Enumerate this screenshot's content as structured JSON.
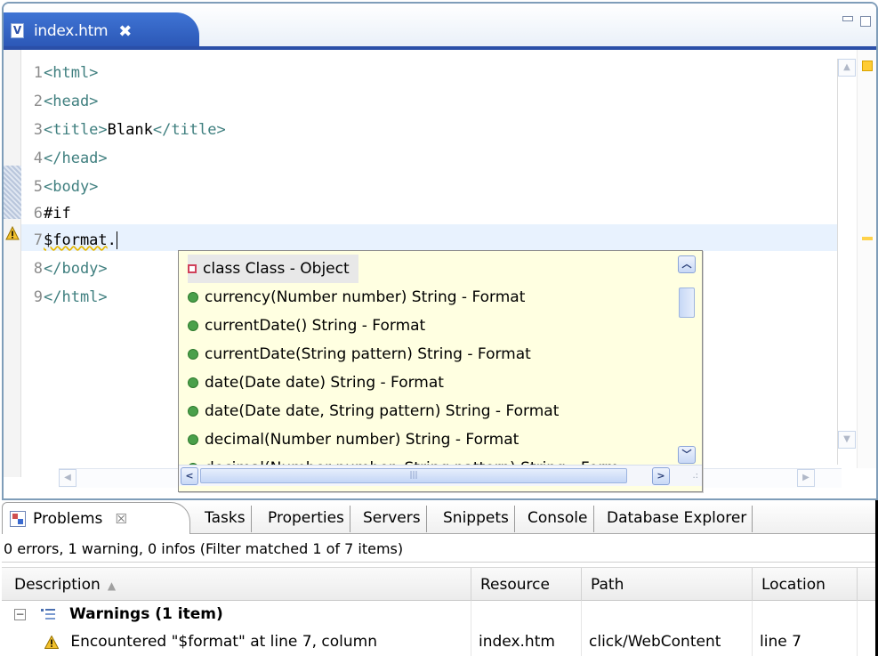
{
  "editor": {
    "tab_label": "index.htm",
    "tab_icon": "V",
    "close_glyph": "✖"
  },
  "code_lines": [
    {
      "num": "1",
      "tokens": [
        {
          "t": "<html>",
          "c": "tag"
        }
      ]
    },
    {
      "num": "2",
      "tokens": [
        {
          "t": "<head>",
          "c": "tag"
        }
      ]
    },
    {
      "num": "3",
      "tokens": [
        {
          "t": "<title>",
          "c": "tag"
        },
        {
          "t": "Blank",
          "c": "plain"
        },
        {
          "t": "</title>",
          "c": "tag"
        }
      ]
    },
    {
      "num": "4",
      "tokens": [
        {
          "t": "</head>",
          "c": "tag"
        }
      ]
    },
    {
      "num": "5",
      "tokens": [
        {
          "t": "<body>",
          "c": "tag"
        }
      ]
    },
    {
      "num": "6",
      "tokens": [
        {
          "t": "#if",
          "c": "plain"
        }
      ]
    },
    {
      "num": "7",
      "tokens": [
        {
          "t": "$format",
          "c": "plain squiggle"
        },
        {
          "t": ".",
          "c": "plain"
        }
      ]
    },
    {
      "num": "8",
      "tokens": [
        {
          "t": "</body>",
          "c": "tag"
        }
      ]
    },
    {
      "num": "9",
      "tokens": [
        {
          "t": "</html>",
          "c": "tag"
        }
      ]
    }
  ],
  "content_assist": {
    "proposals": [
      {
        "label": "class Class - Object",
        "icon": "field-icon",
        "selected": true
      },
      {
        "label": "currency(Number number) String - Format",
        "icon": "method-icon",
        "selected": false
      },
      {
        "label": "currentDate() String - Format",
        "icon": "method-icon",
        "selected": false
      },
      {
        "label": "currentDate(String pattern) String - Format",
        "icon": "method-icon",
        "selected": false
      },
      {
        "label": "date(Date date) String - Format",
        "icon": "method-icon",
        "selected": false
      },
      {
        "label": "date(Date date, String pattern) String - Format",
        "icon": "method-icon",
        "selected": false
      },
      {
        "label": "decimal(Number number) String - Format",
        "icon": "method-icon",
        "selected": false
      },
      {
        "label": "decimal(Number number, String pattern) String - Form",
        "icon": "method-icon",
        "selected": false
      }
    ],
    "hthumb_grip": "|||"
  },
  "views": {
    "problems_label": "Problems",
    "problems_close": "☒",
    "tabs": [
      "Tasks",
      "Properties",
      "Servers",
      "Snippets",
      "Console",
      "Database Explorer"
    ]
  },
  "problems": {
    "summary": "0 errors, 1 warning, 0 infos (Filter matched 1 of 7 items)",
    "columns": [
      "Description",
      "Resource",
      "Path",
      "Location"
    ],
    "group_label": "Warnings (1 item)",
    "rows": [
      {
        "description": "Encountered \"$format\" at line 7, column",
        "resource": "index.htm",
        "path": "click/WebContent",
        "location": "line 7"
      }
    ]
  },
  "colors": {
    "tag": "#3f7f7f",
    "assist_bg": "#ffffe1",
    "tab_active": "#2a55b4",
    "warning": "#f2c12e"
  }
}
